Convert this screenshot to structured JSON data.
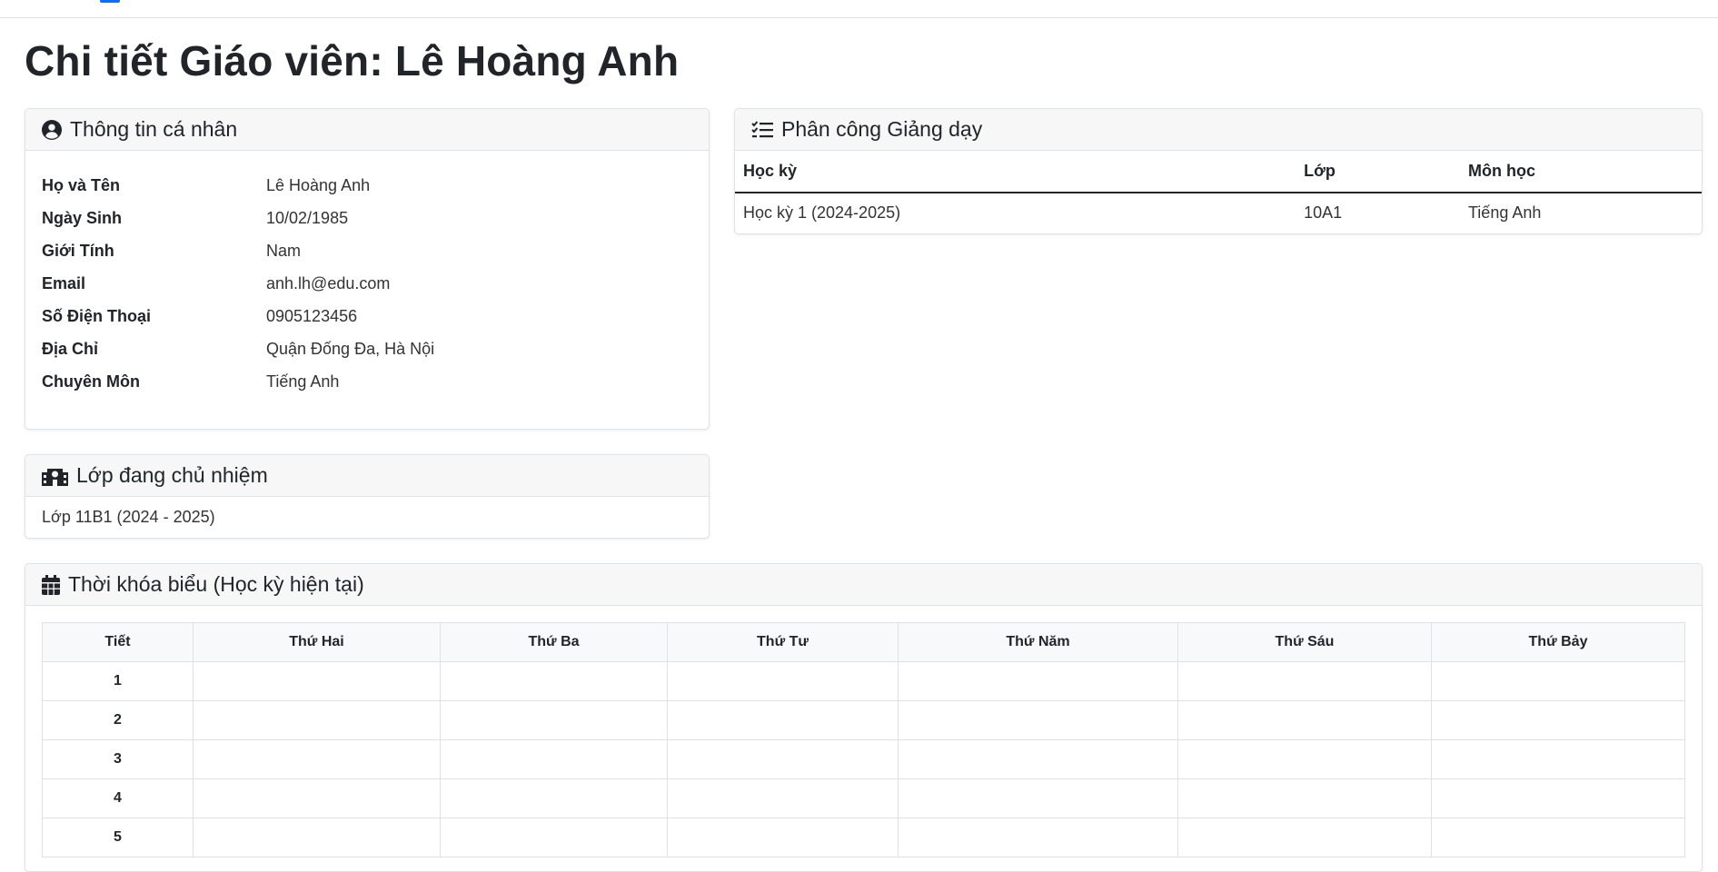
{
  "page": {
    "title": "Chi tiết Giáo viên: Lê Hoàng Anh"
  },
  "personal": {
    "header": "Thông tin cá nhân",
    "icon": "user-circle-icon",
    "fields": [
      {
        "label": "Họ và Tên",
        "value": "Lê Hoàng Anh"
      },
      {
        "label": "Ngày Sinh",
        "value": "10/02/1985"
      },
      {
        "label": "Giới Tính",
        "value": "Nam"
      },
      {
        "label": "Email",
        "value": "anh.lh@edu.com"
      },
      {
        "label": "Số Điện Thoại",
        "value": "0905123456"
      },
      {
        "label": "Địa Chỉ",
        "value": "Quận Đống Đa, Hà Nội"
      },
      {
        "label": "Chuyên Môn",
        "value": "Tiếng Anh"
      }
    ]
  },
  "homeroom": {
    "header": "Lớp đang chủ nhiệm",
    "icon": "school-icon",
    "text": "Lớp 11B1 (2024 - 2025)"
  },
  "assignment": {
    "header": "Phân công Giảng dạy",
    "icon": "list-check-icon",
    "columns": [
      "Học kỳ",
      "Lớp",
      "Môn học"
    ],
    "rows": [
      [
        "Học kỳ 1 (2024-2025)",
        "10A1",
        "Tiếng Anh"
      ]
    ]
  },
  "schedule": {
    "header": "Thời khóa biểu (Học kỳ hiện tại)",
    "icon": "calendar-icon",
    "columns": [
      "Tiết",
      "Thứ Hai",
      "Thứ Ba",
      "Thứ Tư",
      "Thứ Năm",
      "Thứ Sáu",
      "Thứ Bảy"
    ],
    "periods": [
      "1",
      "2",
      "3",
      "4",
      "5"
    ]
  },
  "colors": {
    "accent": "#0d6efd",
    "header_bg": "#f7f7f8",
    "border": "#dee2e6"
  }
}
